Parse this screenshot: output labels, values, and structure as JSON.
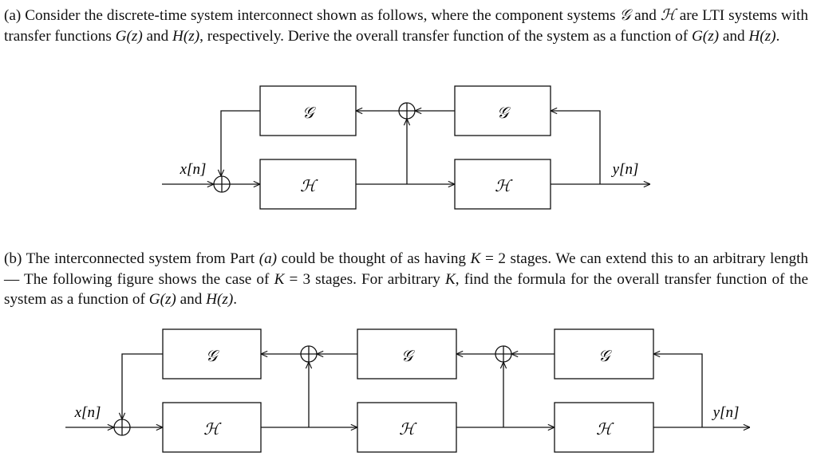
{
  "part_a": {
    "segments": [
      {
        "t": "(a) Consider the discrete-time system interconnect shown as follows, where the component systems "
      },
      {
        "t": "𝒢",
        "m": true
      },
      {
        "t": " and "
      },
      {
        "t": "ℋ",
        "m": true
      },
      {
        "t": " are LTI systems with transfer functions "
      },
      {
        "t": "G(z)",
        "m": true
      },
      {
        "t": " and "
      },
      {
        "t": "H(z)",
        "m": true
      },
      {
        "t": ", respectively. Derive the overall transfer function of the system as a function of "
      },
      {
        "t": "G(z)",
        "m": true
      },
      {
        "t": " and "
      },
      {
        "t": "H(z)",
        "m": true
      },
      {
        "t": "."
      }
    ],
    "diagram": {
      "g_label": "𝒢",
      "h_label": "ℋ",
      "input": "x[n]",
      "output": "y[n]"
    }
  },
  "part_b": {
    "segments": [
      {
        "t": "(b) The interconnected system from Part "
      },
      {
        "t": "(a)",
        "m": true
      },
      {
        "t": " could be thought of as having "
      },
      {
        "t": "K",
        "m": true
      },
      {
        "t": " = 2 stages. We can extend this to an arbitrary length — The following figure shows the case of "
      },
      {
        "t": "K",
        "m": true
      },
      {
        "t": " = 3 stages. For arbitrary "
      },
      {
        "t": "K",
        "m": true
      },
      {
        "t": ", find the formula for the overall transfer function of the system as a function of "
      },
      {
        "t": "G(z)",
        "m": true
      },
      {
        "t": " and "
      },
      {
        "t": "H(z)",
        "m": true
      },
      {
        "t": "."
      }
    ],
    "diagram": {
      "g_label": "𝒢",
      "h_label": "ℋ",
      "input": "x[n]",
      "output": "y[n]"
    }
  }
}
